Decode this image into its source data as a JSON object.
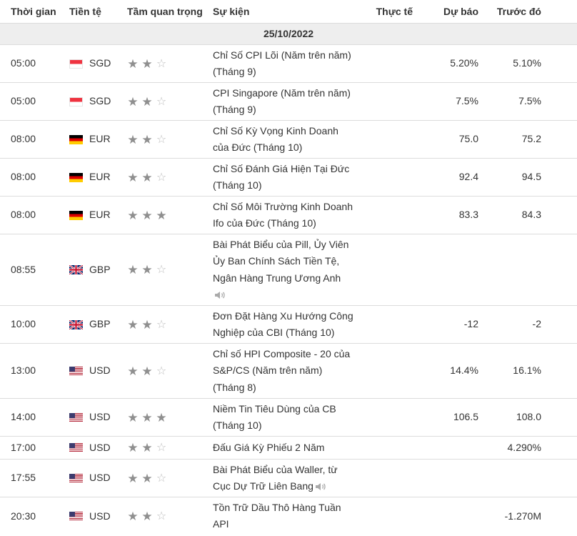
{
  "headers": {
    "time": "Thời gian",
    "currency": "Tiền tệ",
    "importance": "Tầm quan trọng",
    "event": "Sự kiện",
    "actual": "Thực tế",
    "forecast": "Dự báo",
    "previous": "Trước đó"
  },
  "date": "25/10/2022",
  "colors": {
    "date_bg": "#eeeeee",
    "border": "#dcdcdc",
    "star_full": "#8f8f8f",
    "star_empty": "#bcbcbc"
  },
  "rows": [
    {
      "time": "05:00",
      "flag": "sg-flag-icon",
      "currency": "SGD",
      "importance": 2,
      "lines": [
        "Chỉ Số CPI Lõi (Năm trên năm)",
        "(Tháng 9)"
      ],
      "speech": false,
      "actual": "",
      "forecast": "5.20%",
      "previous": "5.10%"
    },
    {
      "time": "05:00",
      "flag": "sg-flag-icon",
      "currency": "SGD",
      "importance": 2,
      "lines": [
        "CPI Singapore (Năm trên năm)",
        "(Tháng 9)"
      ],
      "speech": false,
      "actual": "",
      "forecast": "7.5%",
      "previous": "7.5%"
    },
    {
      "time": "08:00",
      "flag": "de-flag-icon",
      "currency": "EUR",
      "importance": 2,
      "lines": [
        "Chỉ Số Kỳ Vọng Kinh Doanh",
        "của Đức (Tháng 10)"
      ],
      "speech": false,
      "actual": "",
      "forecast": "75.0",
      "previous": "75.2"
    },
    {
      "time": "08:00",
      "flag": "de-flag-icon",
      "currency": "EUR",
      "importance": 2,
      "lines": [
        "Chỉ Số Đánh Giá Hiện Tại Đức",
        "(Tháng 10)"
      ],
      "speech": false,
      "actual": "",
      "forecast": "92.4",
      "previous": "94.5"
    },
    {
      "time": "08:00",
      "flag": "de-flag-icon",
      "currency": "EUR",
      "importance": 3,
      "lines": [
        "Chỉ Số Môi Trường Kinh Doanh",
        "Ifo của Đức (Tháng 10)"
      ],
      "speech": false,
      "actual": "",
      "forecast": "83.3",
      "previous": "84.3"
    },
    {
      "time": "08:55",
      "flag": "gb-flag-icon",
      "currency": "GBP",
      "importance": 2,
      "lines": [
        "Bài Phát Biểu của Pill, Ủy Viên",
        "Ủy Ban Chính Sách Tiền Tệ,",
        "Ngân Hàng Trung Ương Anh"
      ],
      "speech": true,
      "speech_newline": true,
      "actual": "",
      "forecast": "",
      "previous": ""
    },
    {
      "time": "10:00",
      "flag": "gb-flag-icon",
      "currency": "GBP",
      "importance": 2,
      "lines": [
        "Đơn Đặt Hàng Xu Hướng Công",
        "Nghiệp của CBI (Tháng 10)"
      ],
      "speech": false,
      "actual": "",
      "forecast": "-12",
      "previous": "-2"
    },
    {
      "time": "13:00",
      "flag": "us-flag-icon",
      "currency": "USD",
      "importance": 2,
      "lines": [
        "Chỉ số HPI Composite - 20 của",
        "S&P/CS (Năm trên năm)",
        "(Tháng 8)"
      ],
      "speech": false,
      "actual": "",
      "forecast": "14.4%",
      "previous": "16.1%"
    },
    {
      "time": "14:00",
      "flag": "us-flag-icon",
      "currency": "USD",
      "importance": 3,
      "lines": [
        "Niềm Tin Tiêu Dùng của CB",
        "(Tháng 10)"
      ],
      "speech": false,
      "actual": "",
      "forecast": "106.5",
      "previous": "108.0"
    },
    {
      "time": "17:00",
      "flag": "us-flag-icon",
      "currency": "USD",
      "importance": 2,
      "lines": [
        "Đấu Giá Kỳ Phiếu 2 Năm"
      ],
      "speech": false,
      "actual": "",
      "forecast": "",
      "previous": "4.290%"
    },
    {
      "time": "17:55",
      "flag": "us-flag-icon",
      "currency": "USD",
      "importance": 2,
      "lines": [
        "Bài Phát Biểu của Waller, từ",
        "Cục Dự Trữ Liên Bang"
      ],
      "speech": true,
      "speech_newline": false,
      "actual": "",
      "forecast": "",
      "previous": ""
    },
    {
      "time": "20:30",
      "flag": "us-flag-icon",
      "currency": "USD",
      "importance": 2,
      "lines": [
        "Tồn Trữ Dầu Thô Hàng Tuần",
        "API"
      ],
      "speech": false,
      "actual": "",
      "forecast": "",
      "previous": "-1.270M"
    }
  ]
}
